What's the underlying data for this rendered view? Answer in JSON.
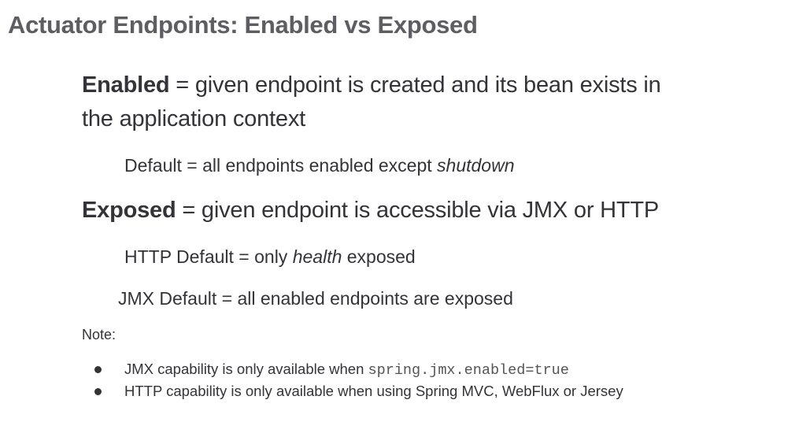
{
  "title": "Actuator Endpoints: Enabled vs Exposed",
  "enabled": {
    "term": "Enabled",
    "definition_line1": " = given endpoint is created and its bean exists in",
    "definition_line2": "the application context",
    "default_prefix": "Default = all endpoints enabled except ",
    "default_em": "shutdown"
  },
  "exposed": {
    "term": "Exposed",
    "definition": " = given endpoint is accessible via JMX or HTTP",
    "http_prefix": "HTTP Default = only ",
    "http_em": "health",
    "http_suffix": " exposed",
    "jmx_default": "JMX Default = all enabled endpoints are exposed"
  },
  "note": {
    "label": "Note:",
    "bullets": [
      {
        "text": "JMX capability is only available when ",
        "code": "spring.jmx.enabled=true"
      },
      {
        "text": "HTTP capability is only available when using Spring MVC, WebFlux or Jersey"
      }
    ]
  }
}
